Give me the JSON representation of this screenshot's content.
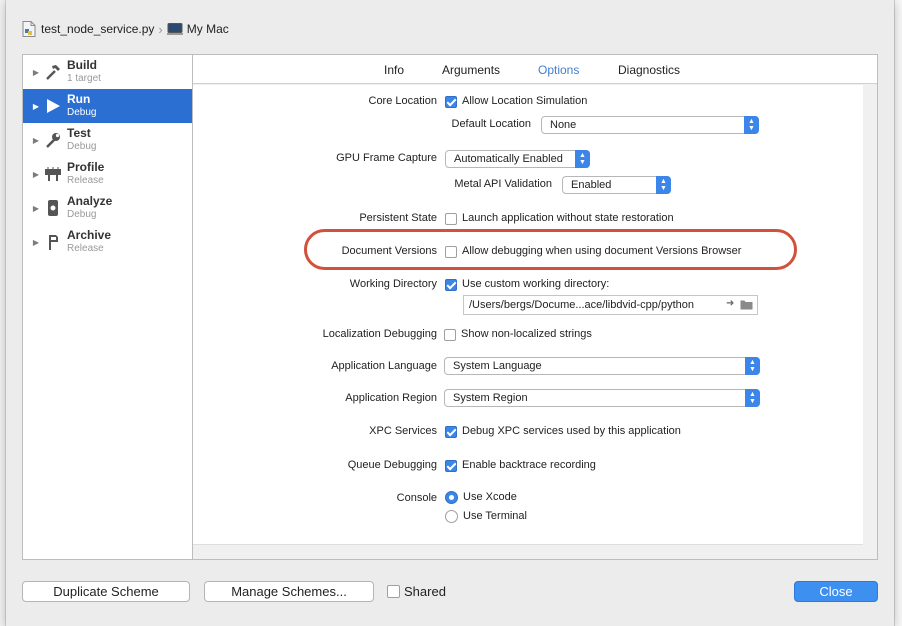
{
  "breadcrumb": {
    "file": "test_node_service.py",
    "destination": "My Mac"
  },
  "sidebar": {
    "actions": [
      {
        "title": "Build",
        "subtitle": "1 target"
      },
      {
        "title": "Run",
        "subtitle": "Debug"
      },
      {
        "title": "Test",
        "subtitle": "Debug"
      },
      {
        "title": "Profile",
        "subtitle": "Release"
      },
      {
        "title": "Analyze",
        "subtitle": "Debug"
      },
      {
        "title": "Archive",
        "subtitle": "Release"
      }
    ]
  },
  "tabs": [
    "Info",
    "Arguments",
    "Options",
    "Diagnostics"
  ],
  "active_tab": "Options",
  "options": {
    "core_location": {
      "label": "Core Location",
      "check": "Allow Location Simulation",
      "checked": true
    },
    "default_location": {
      "label": "Default Location",
      "value": "None"
    },
    "gpu_frame_capture": {
      "label": "GPU Frame Capture",
      "value": "Automatically Enabled"
    },
    "metal_api": {
      "label": "Metal API Validation",
      "value": "Enabled"
    },
    "persistent_state": {
      "label": "Persistent State",
      "check": "Launch application without state restoration",
      "checked": false
    },
    "document_versions": {
      "label": "Document Versions",
      "check": "Allow debugging when using document Versions Browser",
      "checked": false
    },
    "working_directory": {
      "label": "Working Directory",
      "check": "Use custom working directory:",
      "checked": true,
      "path": "/Users/bergs/Docume...ace/libdvid-cpp/python"
    },
    "localization_debugging": {
      "label": "Localization Debugging",
      "check": "Show non-localized strings",
      "checked": false
    },
    "application_language": {
      "label": "Application Language",
      "value": "System Language"
    },
    "application_region": {
      "label": "Application Region",
      "value": "System Region"
    },
    "xpc_services": {
      "label": "XPC Services",
      "check": "Debug XPC services used by this application",
      "checked": true
    },
    "queue_debugging": {
      "label": "Queue Debugging",
      "check": "Enable backtrace recording",
      "checked": true
    },
    "console": {
      "label": "Console",
      "options": [
        "Use Xcode",
        "Use Terminal"
      ],
      "selected": "Use Xcode"
    }
  },
  "footer": {
    "duplicate": "Duplicate Scheme",
    "manage": "Manage Schemes...",
    "shared": "Shared",
    "close": "Close"
  },
  "colors": {
    "accent": "#3b86e8",
    "selection": "#2b6fd3",
    "annotation": "#d2513c"
  }
}
